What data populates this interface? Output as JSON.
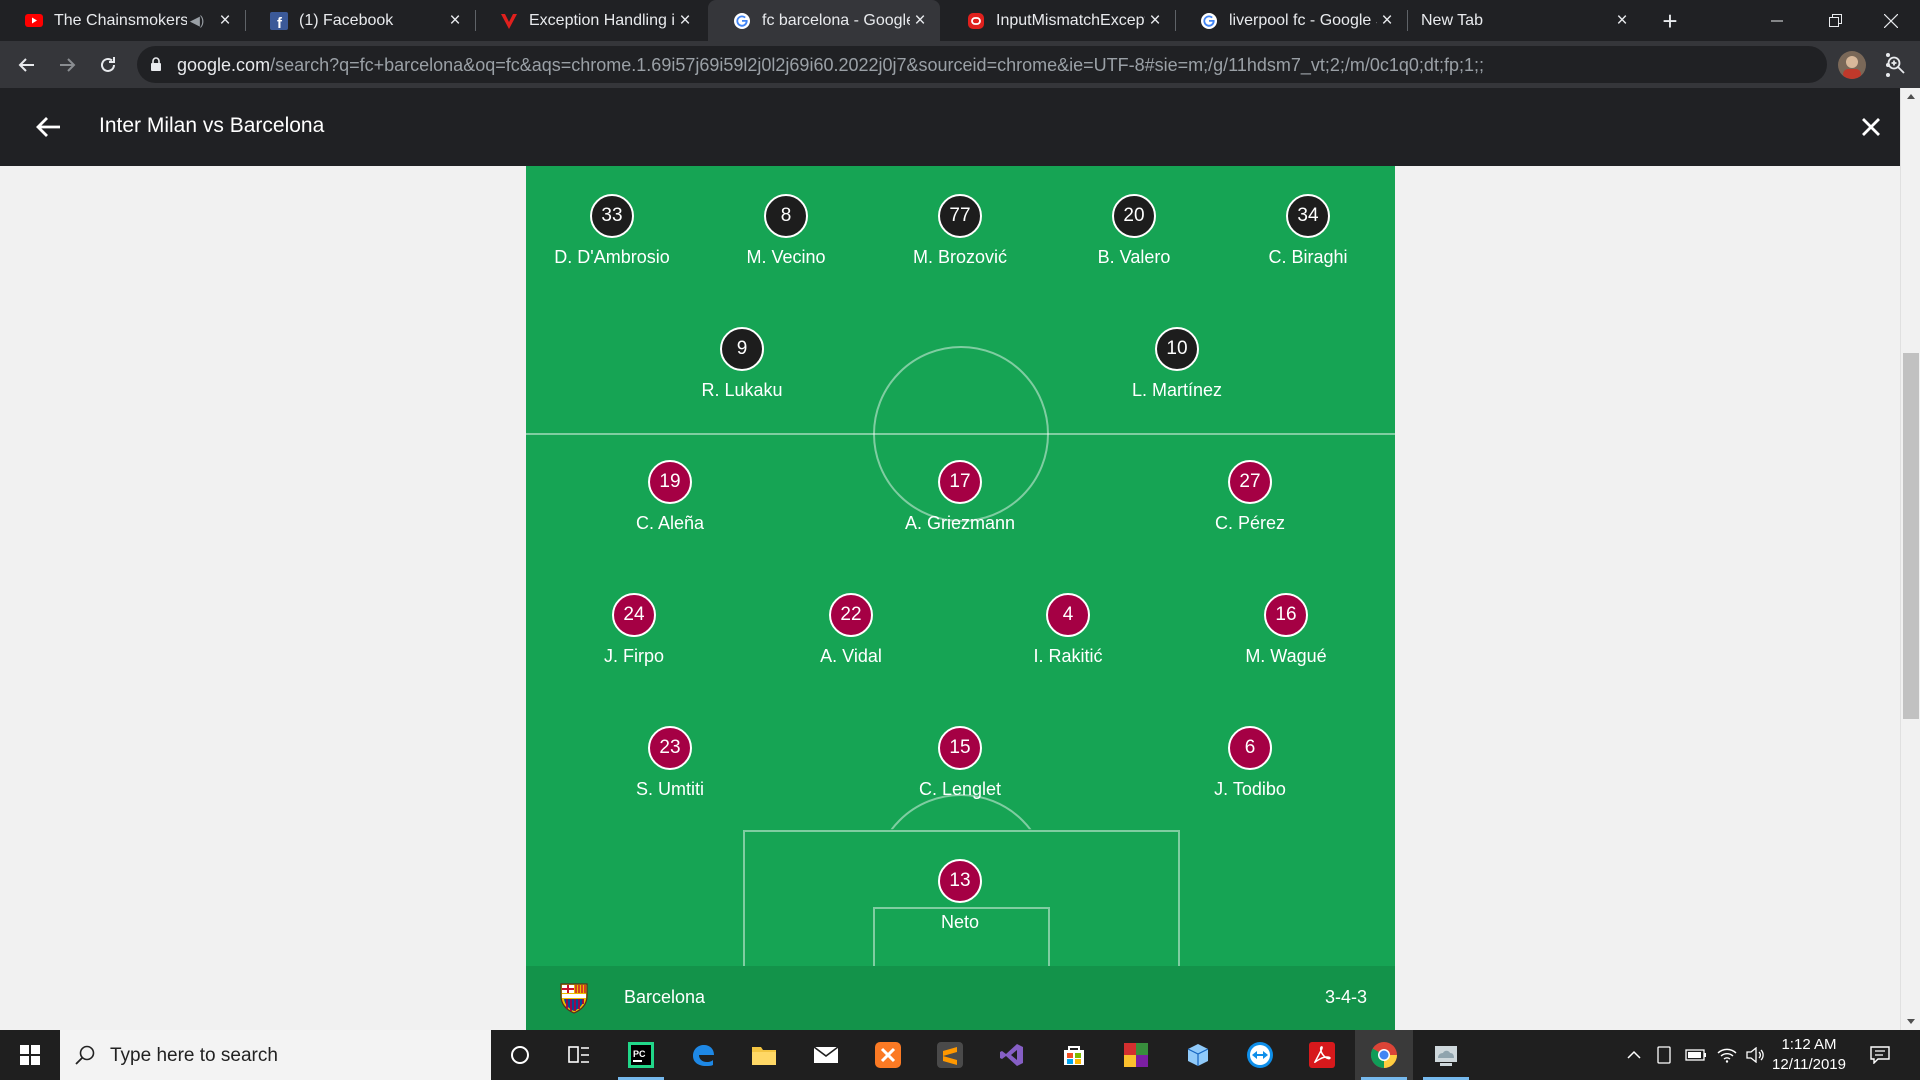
{
  "browser": {
    "tabs": [
      {
        "title": "The Chainsmokers",
        "icon": "youtube-icon",
        "audio": true,
        "active": false
      },
      {
        "title": "(1) Facebook",
        "icon": "facebook-icon",
        "active": false
      },
      {
        "title": "Exception Handling in J",
        "icon": "v-logo-icon",
        "active": false
      },
      {
        "title": "fc barcelona - Google S",
        "icon": "google-icon",
        "active": true
      },
      {
        "title": "InputMismatchExceptic",
        "icon": "red-rounded-icon",
        "active": false
      },
      {
        "title": "liverpool fc - Google Se",
        "icon": "google-icon",
        "active": false
      },
      {
        "title": "New Tab",
        "icon": "",
        "active": false
      }
    ],
    "url_host": "google.com",
    "url_rest": "/search?q=fc+barcelona&oq=fc&aqs=chrome.1.69i57j69i59l2j0l2j69i60.2022j0j7&sourceid=chrome&ie=UTF-8#sie=m;/g/11hdsm7_vt;2;/m/0c1q0;dt;fp;1;;"
  },
  "header": {
    "title": "Inter Milan vs Barcelona"
  },
  "lineup": {
    "inter_back_row": [
      {
        "number": "33",
        "name": "D. D'Ambrosio"
      },
      {
        "number": "8",
        "name": "M. Vecino"
      },
      {
        "number": "77",
        "name": "M. Brozović"
      },
      {
        "number": "20",
        "name": "B. Valero"
      },
      {
        "number": "34",
        "name": "C. Biraghi"
      }
    ],
    "inter_forwards": [
      {
        "number": "9",
        "name": "R. Lukaku"
      },
      {
        "number": "10",
        "name": "L. Martínez"
      }
    ],
    "barca_forwards": [
      {
        "number": "19",
        "name": "C. Aleña"
      },
      {
        "number": "17",
        "name": "A. Griezmann"
      },
      {
        "number": "27",
        "name": "C. Pérez"
      }
    ],
    "barca_midfield": [
      {
        "number": "24",
        "name": "J. Firpo"
      },
      {
        "number": "22",
        "name": "A. Vidal"
      },
      {
        "number": "4",
        "name": "I. Rakitić"
      },
      {
        "number": "16",
        "name": "M. Wagué"
      }
    ],
    "barca_defence": [
      {
        "number": "23",
        "name": "S. Umtiti"
      },
      {
        "number": "15",
        "name": "C. Lenglet"
      },
      {
        "number": "6",
        "name": "J. Todibo"
      }
    ],
    "barca_goalkeeper": {
      "number": "13",
      "name": "Neto"
    }
  },
  "team_bar": {
    "team": "Barcelona",
    "formation": "3-4-3"
  },
  "colors": {
    "pitch": "#16a454",
    "inter_badge": "#1d1d1d",
    "barca_badge": "#a50044"
  },
  "taskbar": {
    "search_placeholder": "Type here to search",
    "time": "1:12 AM",
    "date": "12/11/2019",
    "apps": [
      "task-view-icon",
      "pycharm-icon",
      "edge-icon",
      "file-explorer-icon",
      "mail-icon",
      "xampp-icon",
      "sublime-text-icon",
      "visual-studio-icon",
      "store-icon",
      "winrar-icon",
      "box-3d-icon",
      "teamviewer-icon",
      "acrobat-icon",
      "chrome-icon",
      "cloud-app-icon"
    ]
  }
}
